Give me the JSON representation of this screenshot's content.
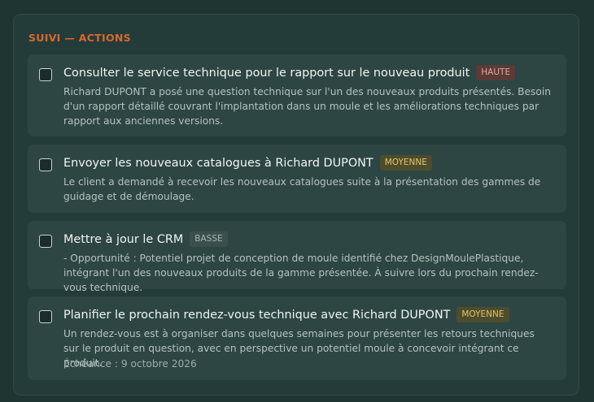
{
  "section": {
    "title": "SUIVI — ACTIONS"
  },
  "actions": [
    {
      "title": "Consulter le service technique pour le rapport sur le nouveau produit",
      "priority": "HAUTE",
      "description": "Richard DUPONT a posé une question technique sur l'un des nouveaux produits présentés. Besoin d'un rapport détaillé couvrant l'implantation dans un moule et les améliorations techniques par rapport aux anciennes versions.",
      "checked": false
    },
    {
      "title": "Envoyer les nouveaux catalogues à Richard DUPONT",
      "priority": "MOYENNE",
      "description": "Le client a demandé à recevoir les nouveaux catalogues suite à la présentation des gammes de guidage et de démoulage.",
      "checked": false
    },
    {
      "title": "Mettre à jour le CRM",
      "priority": "BASSE",
      "description": "- Opportunité : Potentiel projet de conception de moule identifié chez DesignMoulePlastique, intégrant l'un des nouveaux produits de la gamme présentée. À suivre lors du prochain rendez-vous technique.",
      "checked": false
    },
    {
      "title": "Planifier le prochain rendez-vous technique avec Richard DUPONT",
      "priority": "MOYENNE",
      "description": "Un rendez-vous est à organiser dans quelques semaines pour présenter les retours techniques sur le produit en question, avec en perspective un potentiel moule à concevoir intégrant ce produit.",
      "due": "Échéance : 9 octobre 2026",
      "checked": false
    }
  ],
  "colors": {
    "accent": "#d8682d",
    "badge_haute": "#e8a39a",
    "badge_moyenne": "#e4c467",
    "badge_basse": "#a8b5b2"
  }
}
